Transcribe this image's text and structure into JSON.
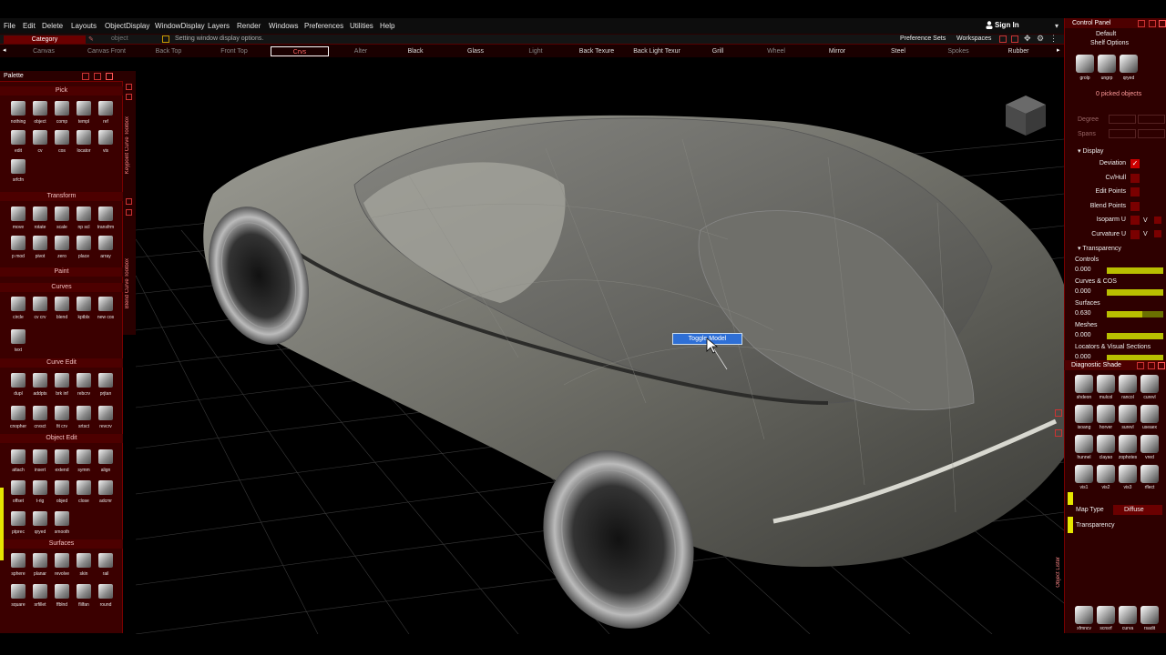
{
  "menu": [
    "File",
    "Edit",
    "Delete",
    "Layouts",
    "ObjectDisplay",
    "WindowDisplay",
    "Layers",
    "Render",
    "Windows",
    "Preferences",
    "Utilities",
    "Help"
  ],
  "signin": "Sign In",
  "prompt": {
    "category": "Category",
    "object": "object",
    "message": "Setting window display options."
  },
  "shelf": [
    "Canvas",
    "Canvas Front",
    "Back Top",
    "Front Top",
    "Crvs",
    "Alter",
    "Black",
    "Glass",
    "Light",
    "Back Texure",
    "Back Light Texur",
    "Grill",
    "Wheel",
    "Mirror",
    "Steel",
    "Spokes",
    "Rubber"
  ],
  "prefs": {
    "pref_sets": "Preference Sets",
    "workspaces": "Workspaces"
  },
  "palette": {
    "title": "Palette",
    "sections": {
      "pick": "Pick",
      "transform": "Transform",
      "paint": "Paint",
      "curves": "Curves",
      "curve_edit": "Curve Edit",
      "object_edit": "Object Edit",
      "surfaces": "Surfaces"
    },
    "pick_tools": [
      "nothing",
      "object",
      "comp",
      "templ",
      "ref",
      "edit",
      "cv",
      "cos",
      "locator",
      "vis",
      "srfcfn"
    ],
    "transform_tools": [
      "move",
      "rotate",
      "scale",
      "np scl",
      "transfrm",
      "p mod",
      "pivot",
      "zero",
      "place",
      "array"
    ],
    "curve_tools": [
      "circle",
      "cv crv",
      "blend",
      "kptblx",
      "new cos",
      "text"
    ],
    "curve_edit_tools": [
      "dupl",
      "addpts",
      "brk inf",
      "rebcrv",
      "prjtan",
      "cnopher",
      "crvsct",
      "fit crv",
      "srtsct",
      "revcrv"
    ],
    "object_edit_tools": [
      "attach",
      "insert",
      "extend",
      "symm",
      "align",
      "offset",
      "t-rig",
      "objed",
      "close",
      "adcmr",
      "ptprec",
      "qryed",
      "smooth"
    ],
    "surface_tools": [
      "sphere",
      "planar",
      "revolve",
      "skin",
      "rail",
      "square",
      "srfillet",
      "ffblnd",
      "flilfan",
      "round"
    ]
  },
  "side_toolboxes": {
    "keypoint": "Keypoint Curve Toolbox",
    "blend": "Blend Curve Toolbox"
  },
  "tooltip": "Toggle Model",
  "control_panel": {
    "title": "Control Panel",
    "default": "Default",
    "shelf_options": "Shelf Options",
    "top_icons": [
      "grolp",
      "ungrp",
      "qryed"
    ],
    "picked": "0 picked objects",
    "degree": "Degree",
    "spans": "Spans",
    "display": "Display",
    "display_items": [
      "Deviation",
      "Cv/Hull",
      "Edit Points",
      "Blend Points",
      "Isoparm U",
      "Curvature U"
    ],
    "isoparm_v": "V",
    "curvature_v": "V",
    "transparency": "Transparency",
    "trans_items": [
      {
        "label": "Controls",
        "value": "0.000",
        "fill": 1.0
      },
      {
        "label": "Curves & COS",
        "value": "0.000",
        "fill": 1.0
      },
      {
        "label": "Surfaces",
        "value": "0.630",
        "fill": 0.63
      },
      {
        "label": "Meshes",
        "value": "0.000",
        "fill": 1.0
      },
      {
        "label": "Locators & Visual Sections",
        "value": "0.000",
        "fill": 1.0
      }
    ]
  },
  "diag_shade": {
    "title": "Diagnostic Shade",
    "items": [
      "shdeon",
      "mulcol",
      "rancol",
      "curevl",
      "isoang",
      "horver",
      "surevl",
      "useaex",
      "hunnel",
      "clayao",
      "zophotes",
      "vred",
      "vis1",
      "vis2",
      "vis3",
      "rflect"
    ],
    "map_type_label": "Map Type",
    "map_type_value": "Diffuse",
    "transparency": "Transparency"
  },
  "object_lister": "Object Lister",
  "bottom_right_tools": [
    "xfmncv",
    "scnsrf",
    "curva",
    "rsadit"
  ]
}
